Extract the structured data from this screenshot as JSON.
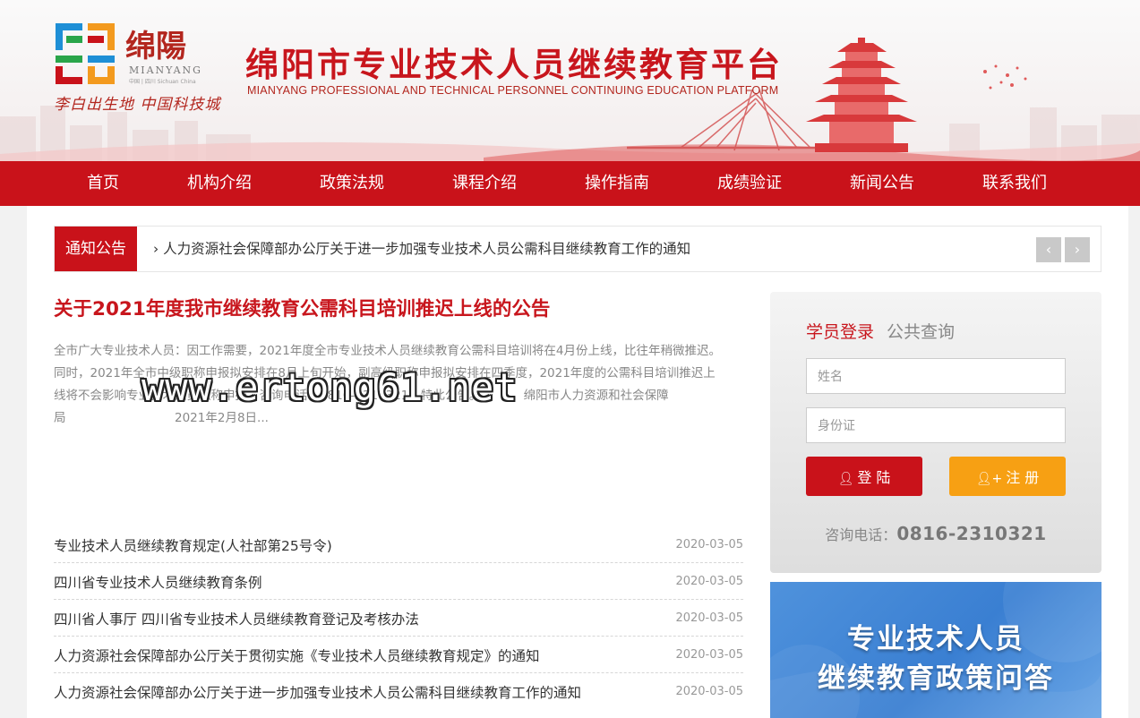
{
  "header": {
    "logo_text": "绵陽",
    "logo_sub": "MIANYANG",
    "logo_tiny": "中国 | 四川 Sichuan China",
    "slogan": "李白出生地 中国科技城",
    "title": "绵阳市专业技术人员继续教育平台",
    "subtitle": "MIANYANG PROFESSIONAL AND TECHNICAL PERSONNEL CONTINUING EDUCATION PLATFORM"
  },
  "nav": {
    "items": [
      {
        "label": "首页"
      },
      {
        "label": "机构介绍"
      },
      {
        "label": "政策法规"
      },
      {
        "label": "课程介绍"
      },
      {
        "label": "操作指南"
      },
      {
        "label": "成绩验证"
      },
      {
        "label": "新闻公告"
      },
      {
        "label": "联系我们"
      }
    ]
  },
  "notice": {
    "label": "通知公告",
    "text": "› 人力资源社会保障部办公厅关于进一步加强专业技术人员公需科目继续教育工作的通知",
    "prev": "‹",
    "next": "›"
  },
  "feature": {
    "title": "关于2021年度我市继续教育公需科目培训推迟上线的公告",
    "body_line1": "全市广大专业技术人员：因工作需要，2021年度全市专业技术人员继续教育公需科目培训将在4月份上线，比往年稍微推迟。",
    "body_line2": "同时，2021年全市中级职称申报拟安排在8月上旬开始，副高级职称申报拟安排在四季度，2021年度的公需科目培训推迟上",
    "body_line3": "线将不会影响专业技术人员职称申报。咨询电话：0816-2310321。特此公告。　　　　绵阳市人力资源和社会保障",
    "body_line4": "局　　　　　　　　　2021年2月8日..."
  },
  "watermark": "www.ertong61.net",
  "news": [
    {
      "title": "专业技术人员继续教育规定(人社部第25号令)",
      "date": "2020-03-05"
    },
    {
      "title": "四川省专业技术人员继续教育条例",
      "date": "2020-03-05"
    },
    {
      "title": "四川省人事厅 四川省专业技术人员继续教育登记及考核办法",
      "date": "2020-03-05"
    },
    {
      "title": "人力资源社会保障部办公厅关于贯彻实施《专业技术人员继续教育规定》的通知",
      "date": "2020-03-05"
    },
    {
      "title": "人力资源社会保障部办公厅关于进一步加强专业技术人员公需科目继续教育工作的通知",
      "date": "2020-03-05"
    }
  ],
  "login": {
    "tab_active": "学员登录",
    "tab_other": "公共查询",
    "name_placeholder": "姓名",
    "id_placeholder": "身份证",
    "login_btn": "登 陆",
    "register_btn": "注 册",
    "phone_label": "咨询电话：",
    "phone_number": "0816-2310321"
  },
  "banner": {
    "line1": "专业技术人员",
    "line2": "继续教育政策问答"
  },
  "colors": {
    "brand_red": "#c9121a",
    "login_btn": "#c9121a",
    "register_btn": "#f7a013",
    "banner_blue": "#3a7fd2"
  }
}
